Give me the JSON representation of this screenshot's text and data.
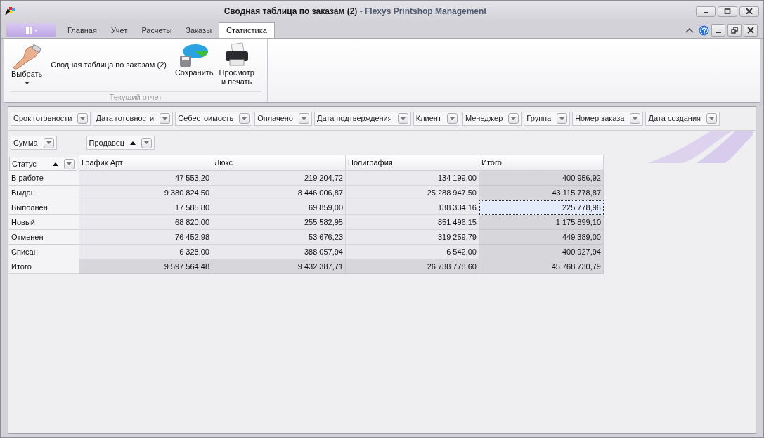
{
  "window": {
    "title": "Сводная таблица по заказам (2)",
    "app_name": " - Flexys Printshop Management"
  },
  "tabs": [
    {
      "label": "Главная",
      "selected": false
    },
    {
      "label": "Учет",
      "selected": false
    },
    {
      "label": "Расчеты",
      "selected": false
    },
    {
      "label": "Заказы",
      "selected": false
    },
    {
      "label": "Статистика",
      "selected": true
    }
  ],
  "ribbon": {
    "group_caption": "Текущий отчет",
    "report_name": "Сводная таблица по заказам (2)",
    "buttons": [
      {
        "kind": "select",
        "label": "Выбрать"
      },
      {
        "kind": "save",
        "label": "Сохранить"
      },
      {
        "kind": "print",
        "label": "Просмотр\nи печать"
      }
    ]
  },
  "filter_fields": [
    {
      "label": "Срок готовности"
    },
    {
      "label": "Дата готовности"
    },
    {
      "label": "Себестоимость"
    },
    {
      "label": "Оплачено"
    },
    {
      "label": "Дата подтверждения"
    },
    {
      "label": "Клиент"
    },
    {
      "label": "Менеджер"
    },
    {
      "label": "Группа"
    },
    {
      "label": "Номер заказа"
    },
    {
      "label": "Дата создания"
    }
  ],
  "data_field": {
    "label": "Сумма"
  },
  "column_field": {
    "label": "Продавец",
    "sorted": true
  },
  "row_field": {
    "label": "Статус",
    "sorted": true
  },
  "table": {
    "columns": [
      "График Арт",
      "Люкс",
      "Полиграфия",
      "Итого"
    ],
    "rows": [
      {
        "label": "В работе",
        "kind": "data",
        "cells": [
          {
            "text": "47 553,20",
            "selected": false
          },
          {
            "text": "219 204,72",
            "selected": false
          },
          {
            "text": "134 199,00",
            "selected": false
          },
          {
            "text": "400 956,92",
            "selected": false
          }
        ]
      },
      {
        "label": "Выдан",
        "kind": "data",
        "cells": [
          {
            "text": "9 380 824,50",
            "selected": false
          },
          {
            "text": "8 446 006,87",
            "selected": false
          },
          {
            "text": "25 288 947,50",
            "selected": false
          },
          {
            "text": "43 115 778,87",
            "selected": false
          }
        ]
      },
      {
        "label": "Выполнен",
        "kind": "data",
        "cells": [
          {
            "text": "17 585,80",
            "selected": false
          },
          {
            "text": "69 859,00",
            "selected": false
          },
          {
            "text": "138 334,16",
            "selected": false
          },
          {
            "text": "225 778,96",
            "selected": true
          }
        ]
      },
      {
        "label": "Новый",
        "kind": "data",
        "cells": [
          {
            "text": "68 820,00",
            "selected": false
          },
          {
            "text": "255 582,95",
            "selected": false
          },
          {
            "text": "851 496,15",
            "selected": false
          },
          {
            "text": "1 175 899,10",
            "selected": false
          }
        ]
      },
      {
        "label": "Отменен",
        "kind": "data",
        "cells": [
          {
            "text": "76 452,98",
            "selected": false
          },
          {
            "text": "53 676,23",
            "selected": false
          },
          {
            "text": "319 259,79",
            "selected": false
          },
          {
            "text": "449 389,00",
            "selected": false
          }
        ]
      },
      {
        "label": "Списан",
        "kind": "data",
        "cells": [
          {
            "text": "6 328,00",
            "selected": false
          },
          {
            "text": "388 057,94",
            "selected": false
          },
          {
            "text": "6 542,00",
            "selected": false
          },
          {
            "text": "400 927,94",
            "selected": false
          }
        ]
      },
      {
        "label": "Итого",
        "kind": "total",
        "cells": [
          {
            "text": "9 597 564,48",
            "selected": false
          },
          {
            "text": "9 432 387,71",
            "selected": false
          },
          {
            "text": "26 738 778,60",
            "selected": false
          },
          {
            "text": "45 768 730,79",
            "selected": false
          }
        ]
      }
    ]
  }
}
